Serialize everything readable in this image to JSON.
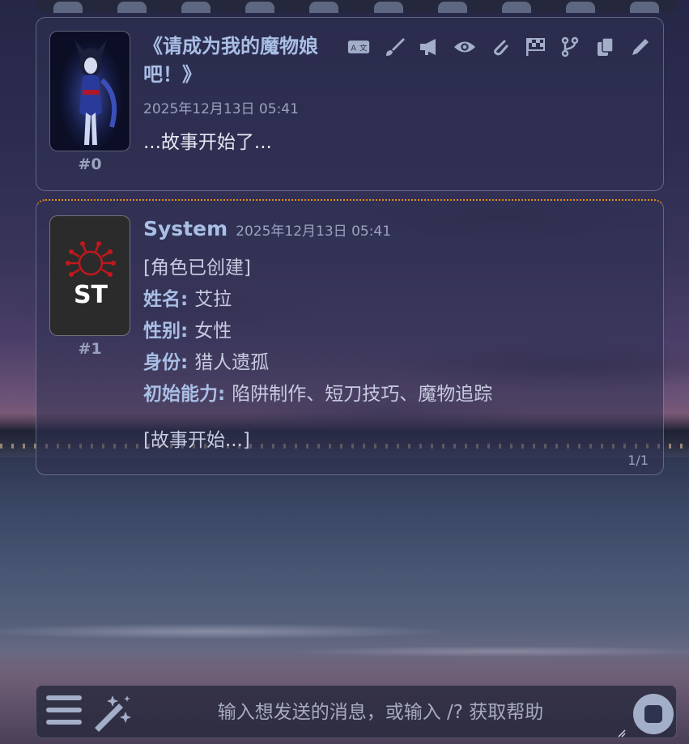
{
  "messages": [
    {
      "id": "#0",
      "title": "《请成为我的魔物娘吧！》",
      "timestamp": "2025年12月13日 05:41",
      "text": "...故事开始了..."
    },
    {
      "id": "#1",
      "name": "System",
      "timestamp": "2025年12月13日 05:41",
      "body": {
        "header": "[角色已创建]",
        "fields": [
          {
            "key": "姓名",
            "sep": ": ",
            "value": "艾拉"
          },
          {
            "key": "性别",
            "sep": ": ",
            "value": "女性"
          },
          {
            "key": "身份",
            "sep": ": ",
            "value": "猎人遗孤"
          },
          {
            "key": "初始能力",
            "sep": ": ",
            "value": "陷阱制作、短刀技巧、魔物追踪"
          }
        ],
        "footer": "[故事开始...]"
      },
      "swipe_counter": "1/1",
      "avatar_text": "ST"
    }
  ],
  "message_actions": [
    "translate-icon",
    "paintbrush-icon",
    "megaphone-icon",
    "eye-icon",
    "paperclip-icon",
    "flag-checkered-icon",
    "branch-icon",
    "copy-icon",
    "pencil-icon"
  ],
  "input": {
    "placeholder": "输入想发送的消息，或输入 /? 获取帮助",
    "value": ""
  },
  "colors": {
    "accent_text": "#a9bfe6",
    "muted_text": "#9aa2bf",
    "edit_border": "#e8891a",
    "logo_red": "#c0181e"
  }
}
